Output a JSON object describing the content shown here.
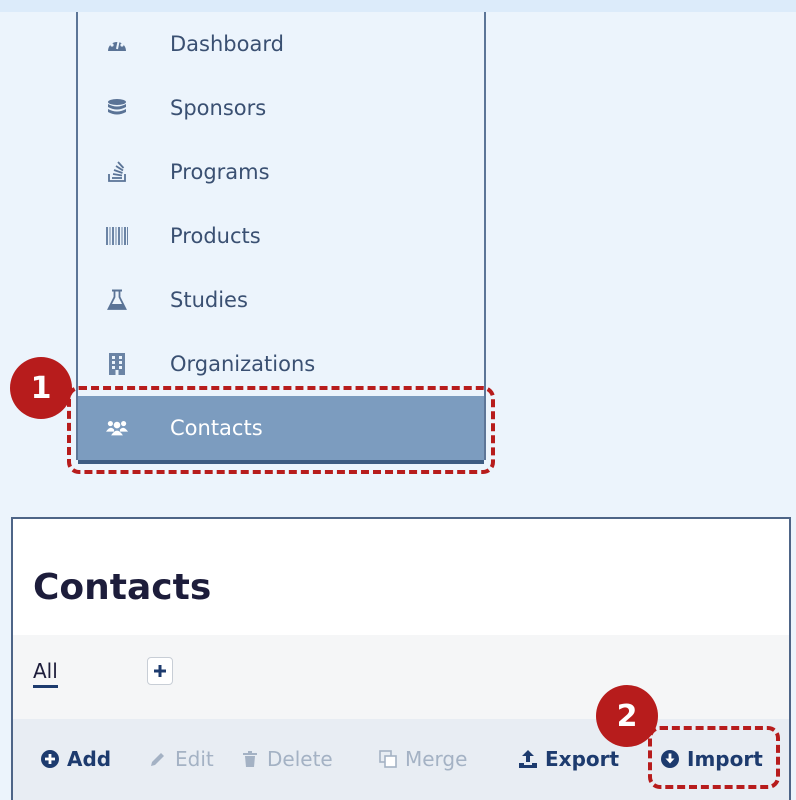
{
  "sidebar": {
    "items": [
      {
        "label": "Dashboard",
        "icon": "dashboard-icon"
      },
      {
        "label": "Sponsors",
        "icon": "database-icon"
      },
      {
        "label": "Programs",
        "icon": "programs-icon"
      },
      {
        "label": "Products",
        "icon": "barcode-icon"
      },
      {
        "label": "Studies",
        "icon": "flask-icon"
      },
      {
        "label": "Organizations",
        "icon": "building-icon"
      },
      {
        "label": "Contacts",
        "icon": "users-icon",
        "active": true
      }
    ]
  },
  "contacts_page": {
    "title": "Contacts",
    "tabs": [
      {
        "label": "All",
        "selected": true
      }
    ],
    "toolbar": {
      "add": "Add",
      "edit": "Edit",
      "delete": "Delete",
      "merge": "Merge",
      "export": "Export",
      "import": "Import"
    }
  },
  "callouts": {
    "step1": "1",
    "step2": "2"
  },
  "colors": {
    "background": "#ecf4fc",
    "active_nav": "#7c9cbf",
    "nav_text": "#3a5072",
    "title_text": "#1d1d3b",
    "toolbar_enabled": "#1d3b6e",
    "toolbar_disabled": "#a4b2c4",
    "callout_red": "#b71c1c"
  }
}
